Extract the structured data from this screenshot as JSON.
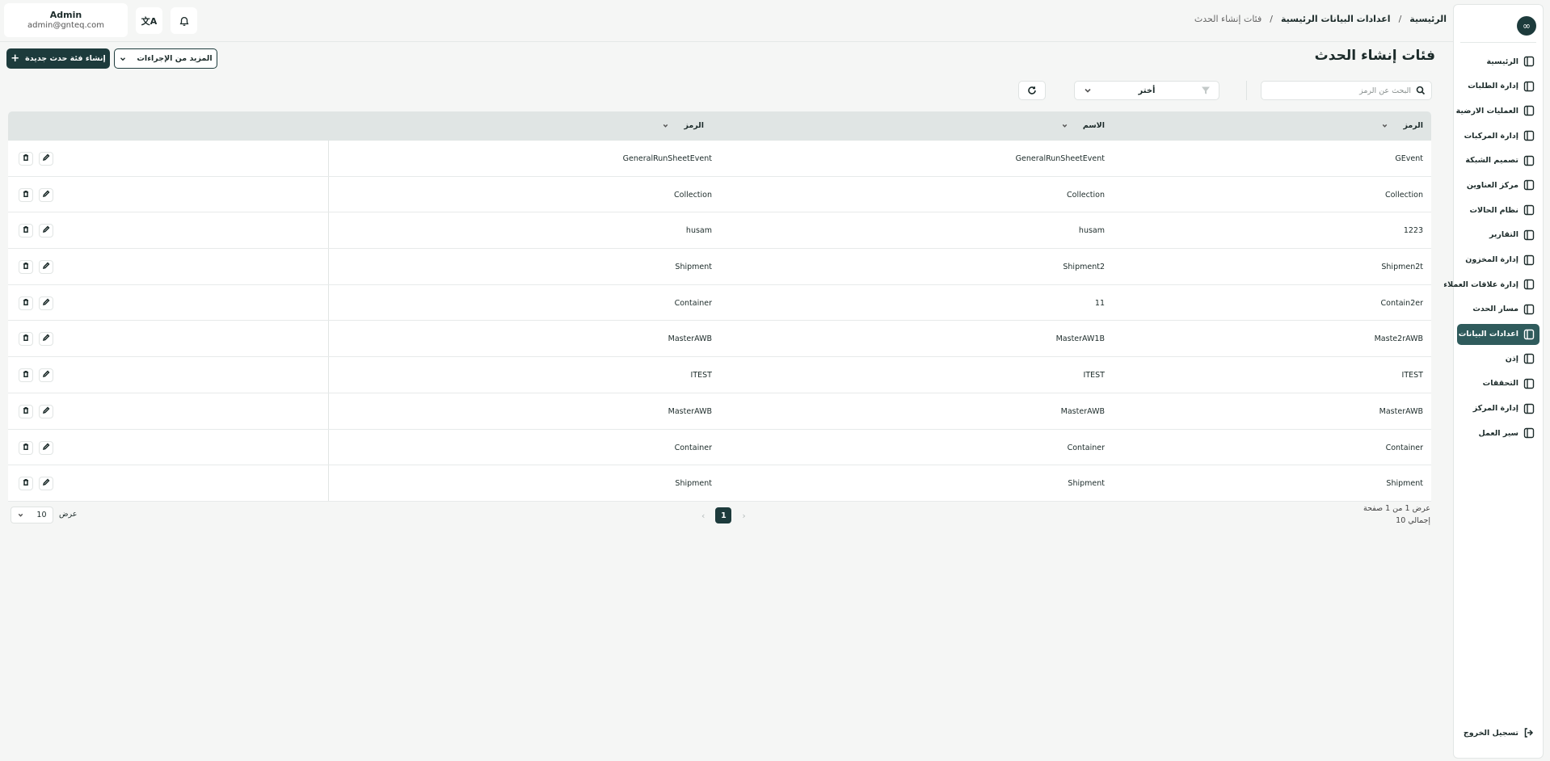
{
  "user": {
    "name": "Admin",
    "email": "admin@gnteq.com"
  },
  "breadcrumb": {
    "home": "الرئيسية",
    "section": "اعدادات البيانات الرئيسية",
    "current": "فئات إنشاء الحدث",
    "separator": "/"
  },
  "page": {
    "title": "فئات إنشاء الحدث",
    "create_button": "إنشاء فئة حدث جديدة",
    "more_button": "المزيد من الإجراءات"
  },
  "filters": {
    "search_placeholder": "البحث عن الرمز",
    "select_value": "أختر"
  },
  "sidebar": {
    "items": [
      {
        "label": "الرئيسية",
        "icon": "layout-icon"
      },
      {
        "label": "إدارة الطلبات",
        "icon": "orders-icon"
      },
      {
        "label": "العمليات الارضية",
        "icon": "ground-ops-icon"
      },
      {
        "label": "إدارة المركبات",
        "icon": "truck-icon"
      },
      {
        "label": "تصميم الشبكة",
        "icon": "network-icon"
      },
      {
        "label": "مركز العناوين",
        "icon": "location-icon"
      },
      {
        "label": "نظام الحالات",
        "icon": "status-icon"
      },
      {
        "label": "التقارير",
        "icon": "report-icon"
      },
      {
        "label": "إدارة المخزون",
        "icon": "inventory-icon"
      },
      {
        "label": "إدارة علاقات العملاء",
        "icon": "crm-icon"
      },
      {
        "label": "مسار الحدث",
        "icon": "route-icon"
      },
      {
        "label": "اعدادات البيانات",
        "icon": "database-icon"
      },
      {
        "label": "إذن",
        "icon": "users-icon"
      },
      {
        "label": "التحققات",
        "icon": "tools-icon"
      },
      {
        "label": "إدارة المركز",
        "icon": "hub-icon"
      },
      {
        "label": "سير العمل",
        "icon": "workflow-icon"
      }
    ],
    "active_index": 11,
    "logout": "تسجيل الخروج"
  },
  "table": {
    "headers": {
      "code": "الرمز",
      "name": "الاسم",
      "code2": "الرمز"
    },
    "rows": [
      {
        "code": "GEvent",
        "name": "GeneralRunSheetEvent",
        "code2": "GeneralRunSheetEvent"
      },
      {
        "code": "Collection",
        "name": "Collection",
        "code2": "Collection"
      },
      {
        "code": "1223",
        "name": "husam",
        "code2": "husam"
      },
      {
        "code": "Shipmen2t",
        "name": "Shipment2",
        "code2": "Shipment"
      },
      {
        "code": "Contain2er",
        "name": "11",
        "code2": "Container"
      },
      {
        "code": "Maste2rAWB",
        "name": "MasterAW1B",
        "code2": "MasterAWB"
      },
      {
        "code": "ITEST",
        "name": "ITEST",
        "code2": "ITEST"
      },
      {
        "code": "MasterAWB",
        "name": "MasterAWB",
        "code2": "MasterAWB"
      },
      {
        "code": "Container",
        "name": "Container",
        "code2": "Container"
      },
      {
        "code": "Shipment",
        "name": "Shipment",
        "code2": "Shipment"
      }
    ]
  },
  "pagination": {
    "info": "عرض 1 من 1 صفحة",
    "total": "إجمالي 10",
    "current_page": "1",
    "per_page": "10",
    "per_page_label": "عرض"
  },
  "colors": {
    "primary": "#1d3b3c",
    "active_nav": "#2f5b5c",
    "header_row": "#e0e5e4"
  }
}
